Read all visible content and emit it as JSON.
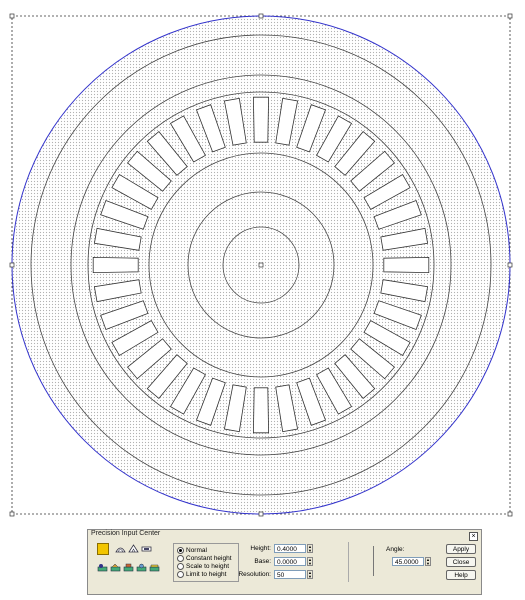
{
  "panel": {
    "title": "Precision Input Center",
    "close_glyph": "×",
    "modes": [
      {
        "label": "Normal",
        "selected": true
      },
      {
        "label": "Constant height",
        "selected": false
      },
      {
        "label": "Scale to height",
        "selected": false
      },
      {
        "label": "Limit to height",
        "selected": false
      }
    ],
    "height": {
      "label": "Height:",
      "value": "0.4000"
    },
    "base": {
      "label": "Base:",
      "value": "0.0000"
    },
    "resolution": {
      "label": "Resolution:",
      "value": "50"
    },
    "angle": {
      "label": "Angle:",
      "value": "45.0000"
    },
    "buttons": {
      "apply": "Apply",
      "close": "Close",
      "help": "Help"
    }
  },
  "icons": {
    "color_swatch": "color-swatch-icon",
    "top_tools": [
      "dome-icon",
      "arch-icon",
      "bar-icon"
    ],
    "bottom_tools": [
      "tool-a-icon",
      "tool-b-icon",
      "tool-c-icon",
      "tool-d-icon",
      "tool-e-icon"
    ]
  },
  "colors": {
    "selection_circle": "#3333cc",
    "cut_line": "#cc3333",
    "swatch": "#f2c500"
  },
  "design": {
    "slot_count": 36
  }
}
